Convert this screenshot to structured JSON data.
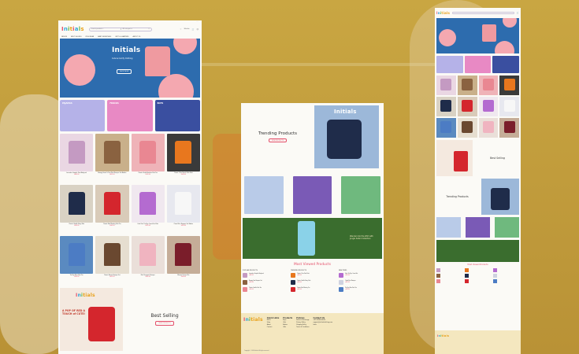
{
  "brand": {
    "logo_letters": [
      "I",
      "n",
      "i",
      "t",
      "i",
      "a",
      "l",
      "s"
    ],
    "accent": "#e44f6a",
    "blue": "#2d6cae",
    "pink": "#f4a8b0"
  },
  "left": {
    "search_placeholder": "Search products...",
    "search_category": "All categories",
    "cart_label": "Wishlist",
    "nav": [
      "NEW IN",
      "BEST SELLING",
      "KIDS WEAR",
      "BABY ESSENTIALS",
      "GIFTS & HAMPERS",
      "ABOUT US"
    ],
    "hero_tagline": "Cute & Comfy Clothing",
    "hero_cta": "SHOP NOW",
    "categories": [
      {
        "label": "PAJAMAS",
        "color": "#b5b2e8"
      },
      {
        "label": "FROCKS",
        "color": "#e889c4"
      },
      {
        "label": "BOYS",
        "color": "#3a4fa0"
      }
    ],
    "products": [
      {
        "name": "Lavender Graphic Print Bodysuit",
        "price": "₹449.00",
        "bg": "#ead7e3",
        "shirt": "#c49ac2"
      },
      {
        "name": "Bumpy Heart & Star Print Romper Set Babies",
        "price": "₹499.00",
        "bg": "#c9b08a",
        "shirt": "#8a6240"
      },
      {
        "name": "Classic Giraffe Antlers Polo Tee",
        "price": "₹549.00",
        "bg": "#efb3b8",
        "shirt": "#e98792"
      },
      {
        "name": "Classic Olive Bunch Polo Shirt",
        "price": "₹549.00",
        "bg": "#3a3a3a",
        "shirt": "#e8771e"
      },
      {
        "name": "Classic Giraffe Navy Polo",
        "price": "₹549.00",
        "bg": "#d9d2c4",
        "shirt": "#1f2c4a"
      },
      {
        "name": "Classic Red Monkey Polo Tee",
        "price": "₹549.00",
        "bg": "#d9cbb9",
        "shirt": "#d4262d"
      },
      {
        "name": "Lilac Pink Tie-Dye Coord Set Kids",
        "price": "₹699.00",
        "bg": "#f0e8ef",
        "shirt": "#b46bd0"
      },
      {
        "name": "Cloud Print Romper Set Babies",
        "price": "₹499.00",
        "bg": "#e7e8ef",
        "shirt": "#f7f7f7"
      },
      {
        "name": "Tie-Dye Blue Polo Tee",
        "price": "₹549.00",
        "bg": "#5a8ac0",
        "shirt": "#4c7cc4"
      },
      {
        "name": "Classic Brown Romper Set",
        "price": "₹499.00",
        "bg": "#e6ded0",
        "shirt": "#6a4830"
      },
      {
        "name": "Pink Sleepsuit Romper",
        "price": "₹449.00",
        "bg": "#eadfd9",
        "shirt": "#f0b4c0"
      },
      {
        "name": "Maroon Printed Tee",
        "price": "₹549.00",
        "bg": "#c5ad98",
        "shirt": "#7a1d2a"
      }
    ],
    "best_banner_text": "A POP OF RED A TOUCH of CUTE!",
    "best_title": "Best Selling",
    "best_cta": "VIEW PRODUCTS"
  },
  "center": {
    "trending_title": "Trending Products",
    "trending_cta": "VIEW PRODUCTS",
    "jungle_text": "Wander into the Wild with Jungle Safari Collection",
    "most_viewed_title": "Most Viewed Products",
    "mv_cols": [
      {
        "heading": "POPULAR PRODUCTS",
        "items": [
          {
            "name": "Lavender Graphic Bodysuit",
            "price": "₹449.00",
            "color": "#c49ac2"
          },
          {
            "name": "Bumpy Star Romper Set",
            "price": "₹499.00",
            "color": "#8a6240"
          },
          {
            "name": "Classic Giraffe Polo Tee",
            "price": "₹549.00",
            "color": "#e98792"
          }
        ]
      },
      {
        "heading": "TRENDING PRODUCTS",
        "items": [
          {
            "name": "Classic Olive Polo Shirt",
            "price": "₹549.00",
            "color": "#e8771e"
          },
          {
            "name": "Classic Giraffe Navy Polo",
            "price": "₹549.00",
            "color": "#1f2c4a"
          },
          {
            "name": "Classic Red Monkey Tee",
            "price": "₹549.00",
            "color": "#d4262d"
          }
        ]
      },
      {
        "heading": "NEW ITEMS",
        "items": [
          {
            "name": "Lilac Tie-Dye Coord Set",
            "price": "₹699.00",
            "color": "#b46bd0"
          },
          {
            "name": "Cloud Print Romper",
            "price": "₹499.00",
            "color": "#cfd2e0"
          },
          {
            "name": "Tie-Dye Blue Polo Tee",
            "price": "₹549.00",
            "color": "#4c7cc4"
          }
        ]
      }
    ],
    "footer": {
      "quick_links": {
        "heading": "Quick Links",
        "items": [
          "Home",
          "Shop",
          "About",
          "Contact"
        ]
      },
      "products": {
        "heading": "Products",
        "items": [
          "Boys",
          "Girls",
          "Babies",
          "Gifts"
        ]
      },
      "policies": {
        "heading": "Policies",
        "items": [
          "Return & Exchange",
          "Privacy Policy",
          "Shipping Policy",
          "Terms & Conditions"
        ]
      },
      "contact": {
        "heading": "Contact Us",
        "items": [
          "+91 00000 00000",
          "support@initialsclothing.com",
          "India"
        ]
      },
      "copyright": "Copyright © 2024 Initials. All rights reserved."
    }
  },
  "right": {
    "best_title": "Best Selling",
    "trending_title": "Trending Products",
    "mv_title": "Most Viewed Products"
  }
}
